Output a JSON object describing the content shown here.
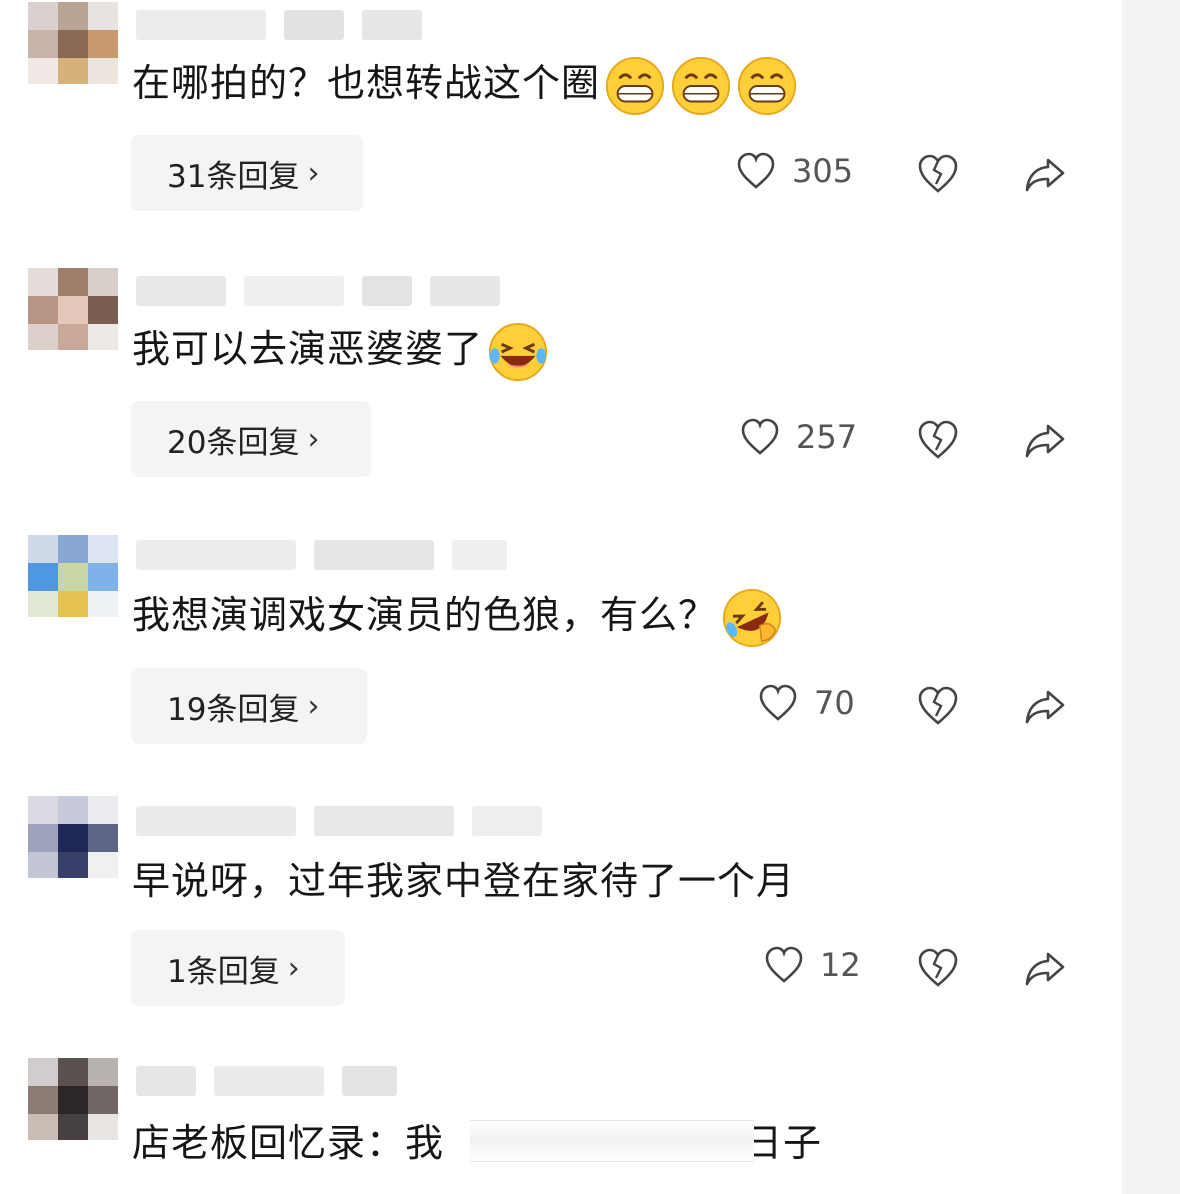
{
  "comments": [
    {
      "text": "在哪拍的？也想转战这个圈",
      "emojis": [
        "grin-emoji",
        "grin-emoji",
        "grin-emoji"
      ],
      "replies": "31条回复",
      "likes": "305"
    },
    {
      "text": "我可以去演恶婆婆了",
      "emojis": [
        "laugh-emoji"
      ],
      "replies": "20条回复",
      "likes": "257"
    },
    {
      "text": "我想演调戏女演员的色狼，有么？",
      "emojis": [
        "rofl-emoji"
      ],
      "replies": "19条回复",
      "likes": "70"
    },
    {
      "text": "早说呀，过年我家中登在家待了一个月",
      "emojis": [],
      "replies": "1条回复",
      "likes": "12"
    },
    {
      "text_prefix": "店老板回忆录：我",
      "text_suffix": "日子"
    }
  ],
  "icons": {
    "like": "heart-outline-icon",
    "dislike": "broken-heart-icon",
    "share": "share-arrow-icon",
    "chevron": "chevron-right-icon"
  },
  "colors": {
    "text": "#161616",
    "pill_bg": "#f4f4f6",
    "icon": "#555555",
    "emoji_yellow": "#ffcf3a"
  }
}
